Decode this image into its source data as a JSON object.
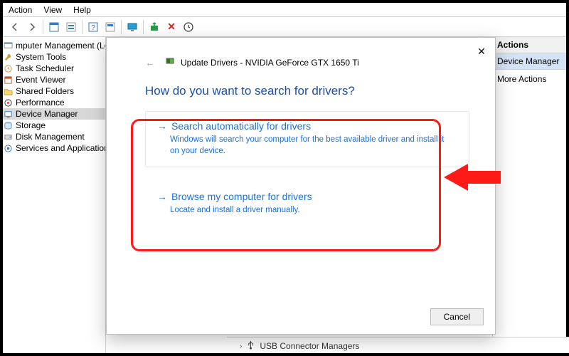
{
  "menubar": {
    "action": "Action",
    "view": "View",
    "help": "Help"
  },
  "left": {
    "root": "mputer Management (Local)",
    "system_tools": "System Tools",
    "task_scheduler": "Task Scheduler",
    "event_viewer": "Event Viewer",
    "shared_folders": "Shared Folders",
    "performance": "Performance",
    "device_manager": "Device Manager",
    "storage": "Storage",
    "disk_management": "Disk Management",
    "services": "Services and Applications"
  },
  "right": {
    "header": "Actions",
    "selected": "Device Manager",
    "more": "More Actions"
  },
  "dialog": {
    "title": "Update Drivers - NVIDIA GeForce GTX 1650 Ti",
    "heading": "How do you want to search for drivers?",
    "opt1_title": "Search automatically for drivers",
    "opt1_desc": "Windows will search your computer for the best available driver and install it on your device.",
    "opt2_title": "Browse my computer for drivers",
    "opt2_desc": "Locate and install a driver manually.",
    "cancel": "Cancel"
  },
  "peek": {
    "label": "USB Connector Managers"
  }
}
